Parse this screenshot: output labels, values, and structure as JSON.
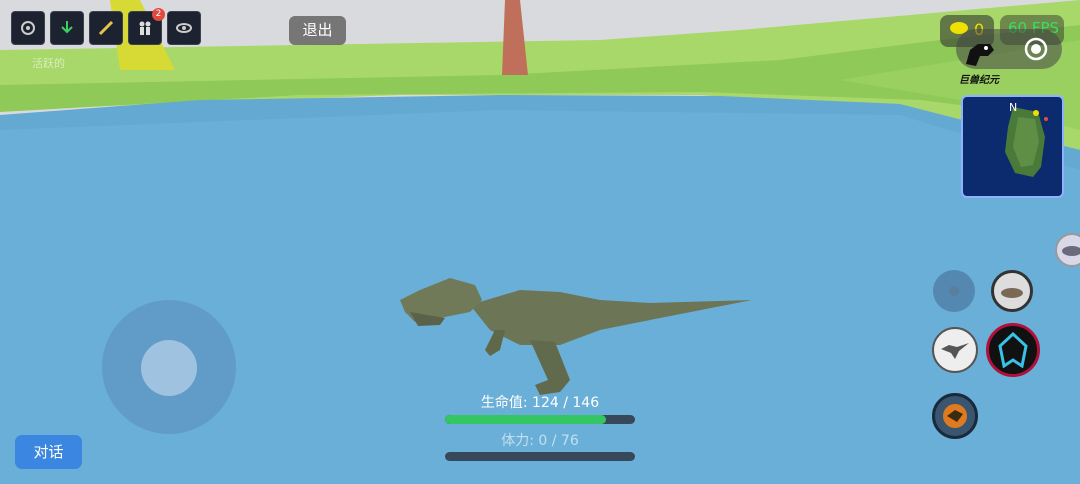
{
  "exit_label": "退出",
  "toolbar": {
    "icons": [
      "settings-icon",
      "download-icon",
      "bone-icon",
      "players-icon",
      "eye-icon"
    ],
    "players_badge": "2"
  },
  "dim_label": "活跃的",
  "currency": {
    "amount": "0"
  },
  "fps_label": "60 FPS",
  "logo_text": "巨兽纪元",
  "minimap": {
    "north_label": "N"
  },
  "health": {
    "label": "生命值",
    "current": 124,
    "max": 146,
    "text": "124 / 146",
    "color": "#34c662"
  },
  "stamina": {
    "label": "体力",
    "current": 0,
    "max": 76,
    "text": "0 / 76"
  },
  "chat_label": "对话",
  "skills": [
    "roar-icon",
    "lay-down-icon",
    "raptor-icon",
    "dino-head-icon",
    "trex-icon",
    "herbivore-icon"
  ]
}
